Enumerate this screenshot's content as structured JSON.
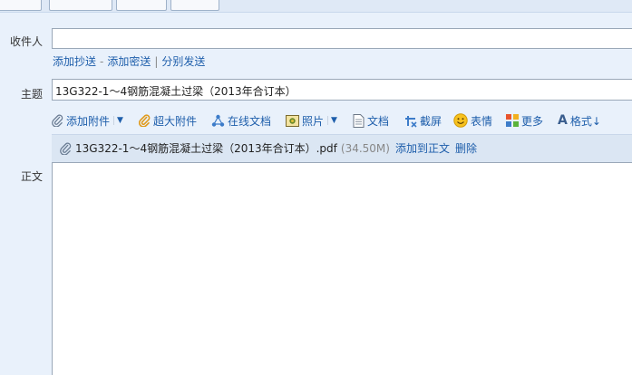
{
  "form": {
    "to_label": "收件人",
    "to_value": "",
    "subject_label": "主题",
    "subject_value": "13G322-1～4钢筋混凝土过梁（2013年合订本）",
    "body_label": "正文",
    "body_value": ""
  },
  "recipient_links": [
    {
      "label": "添加抄送"
    },
    {
      "label": "添加密送"
    },
    {
      "label": "分别发送"
    }
  ],
  "toolbar": {
    "add_attachment": "添加附件",
    "large_attachment": "超大附件",
    "online_doc": "在线文档",
    "photo": "照片",
    "document": "文档",
    "screenshot": "截屏",
    "emoji": "表情",
    "more": "更多",
    "format": "格式↓"
  },
  "attachment": {
    "filename": "13G322-1～4钢筋混凝土过梁（2013年合订本）.pdf",
    "size": "(34.50M)",
    "add_to_body": "添加到正文",
    "delete": "删除"
  },
  "icons": [
    "paperclip-icon",
    "caret-down-icon",
    "orange-clip-icon",
    "share-nodes-icon",
    "photo-icon",
    "document-icon",
    "scissors-icon",
    "smiley-icon",
    "grid-icon",
    "text-format-icon"
  ]
}
